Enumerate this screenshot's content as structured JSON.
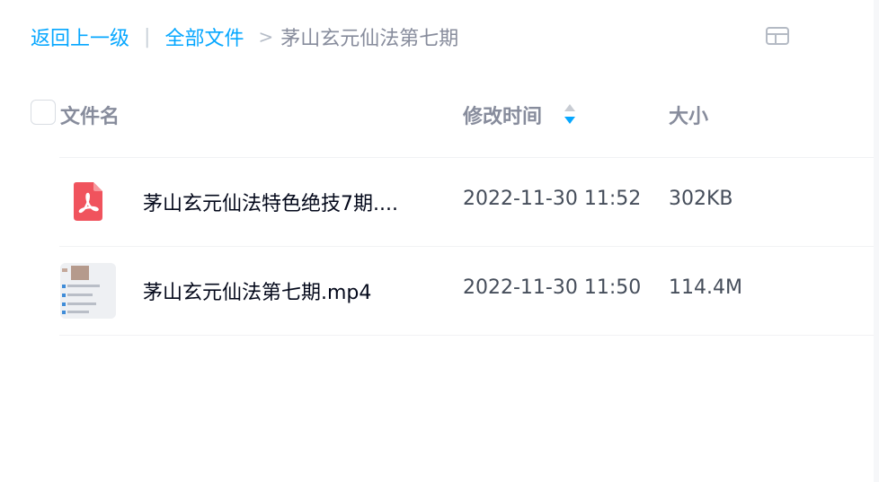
{
  "breadcrumb": {
    "back": "返回上一级",
    "separator": "|",
    "root": "全部文件",
    "arrow": ">",
    "current": "茅山玄元仙法第七期"
  },
  "table": {
    "headers": {
      "name": "文件名",
      "modified": "修改时间",
      "size": "大小"
    },
    "rows": [
      {
        "name": "茅山玄元仙法特色绝技7期....",
        "modified": "2022-11-30 11:52",
        "size": "302KB",
        "icon": "pdf-file-icon"
      },
      {
        "name": "茅山玄元仙法第七期.mp4",
        "modified": "2022-11-30 11:50",
        "size": "114.4M",
        "icon": "video-thumbnail"
      }
    ]
  },
  "colors": {
    "accent": "#06a7ff",
    "pdf_red": "#f0535d",
    "header_gray": "#878c9c",
    "text_dark": "#03081a"
  }
}
